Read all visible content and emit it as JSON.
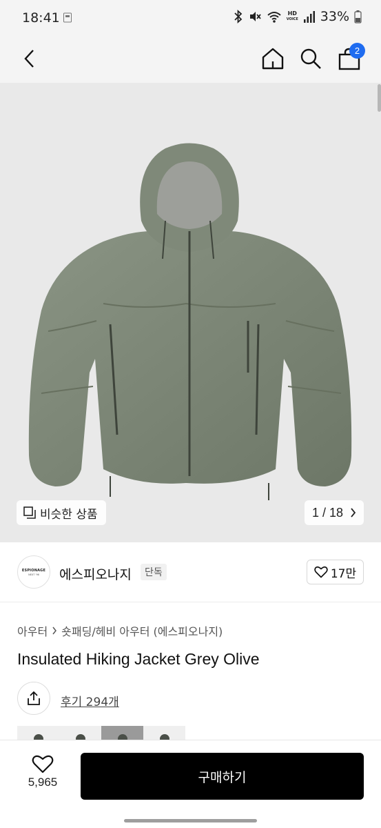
{
  "status_bar": {
    "time": "18:41",
    "battery": "33%",
    "hd_label": "HD",
    "voice_label": "VOICE"
  },
  "nav": {
    "cart_count": "2"
  },
  "gallery": {
    "similar_label": "비슷한 상품",
    "page_indicator": "1 / 18"
  },
  "brand": {
    "name": "에스피오나지",
    "tag": "단독",
    "logo_text": "ESPIONAGE",
    "logo_sub": "NEXT '96",
    "like_count": "17만"
  },
  "breadcrumb": {
    "category": "아우터",
    "subcategory": "숏패딩/헤비 아우터 (에스피오나지)"
  },
  "product": {
    "title": "Insulated Hiking Jacket Grey Olive",
    "reviews_label": "후기 294개"
  },
  "bottom_bar": {
    "like_count": "5,965",
    "buy_label": "구매하기"
  },
  "colors": {
    "accent": "#1f6cf0",
    "jacket": "#7b8575",
    "image_bg": "#e9e9e9"
  }
}
